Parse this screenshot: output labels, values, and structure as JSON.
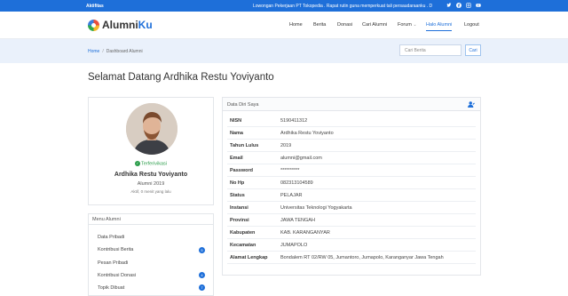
{
  "topbar": {
    "aktifitas": "Aktifitas",
    "marquee": "Lowongan Pekerjaan PT Tokopedia . Rapat rutin guna memperkuat tali persaudaraanku . D"
  },
  "brand": {
    "name_prefix": "Alumni",
    "name_suffix": "Ku"
  },
  "nav": {
    "home": "Home",
    "berita": "Berita",
    "donasi": "Donasi",
    "cari_alumni": "Cari Alumni",
    "forum": "Forum",
    "halo_alumni": "Halo Alumni",
    "logout": "Logout"
  },
  "breadcrumb": {
    "home": "Home",
    "separator": "/",
    "current": "Dashboard Alumni"
  },
  "search": {
    "placeholder": "Cari Berita",
    "button": "Cari"
  },
  "page_title": "Selamat Datang Ardhika Restu Yoviyanto",
  "profile": {
    "status": "Terferivikasi",
    "name": "Ardhika Restu Yoviyanto",
    "alumni": "Alumni 2019",
    "active": "Aktif, 0 menit yang lalu"
  },
  "menu": {
    "title": "Menu Alumni",
    "items": [
      {
        "label": "Data Pribadi",
        "badge": ""
      },
      {
        "label": "Kontribusi Berita",
        "badge": "5"
      },
      {
        "label": "Pesan Pribadi",
        "badge": ""
      },
      {
        "label": "Kontribusi Donasi",
        "badge": "4"
      },
      {
        "label": "Topik Dibuat",
        "badge": "7"
      }
    ]
  },
  "data_diri": {
    "title": "Data Diri Saya",
    "rows": [
      {
        "label": "NISN",
        "value": "5190411312"
      },
      {
        "label": "Nama",
        "value": "Ardhika Restu Yoviyanto"
      },
      {
        "label": "Tahun Lulus",
        "value": "2019"
      },
      {
        "label": "Email",
        "value": "alumni@gmail.com"
      },
      {
        "label": "Password",
        "value": "**********"
      },
      {
        "label": "No Hp",
        "value": "082313104589"
      },
      {
        "label": "Status",
        "value": "PELAJAR"
      },
      {
        "label": "Instansi",
        "value": "Universitas Teknologi Yogyakarta"
      },
      {
        "label": "Provinsi",
        "value": "JAWA TENGAH"
      },
      {
        "label": "Kabupaten",
        "value": "KAB. KARANGANYAR"
      },
      {
        "label": "Kecamatan",
        "value": "JUMAPOLO"
      },
      {
        "label": "Alamat Lengkap",
        "value": "Bondalem RT 02/RW 05, Jumantoro, Jumapolo, Karanganyar Jawa Tengah"
      }
    ]
  },
  "colors": {
    "primary": "#1e6fd9",
    "success": "#2a9d4a"
  },
  "icons": [
    "instagram-icon",
    "facebook-icon",
    "twitter-icon",
    "youtube-icon",
    "user-edit-icon",
    "check-circle-icon",
    "chevron-down-icon"
  ]
}
